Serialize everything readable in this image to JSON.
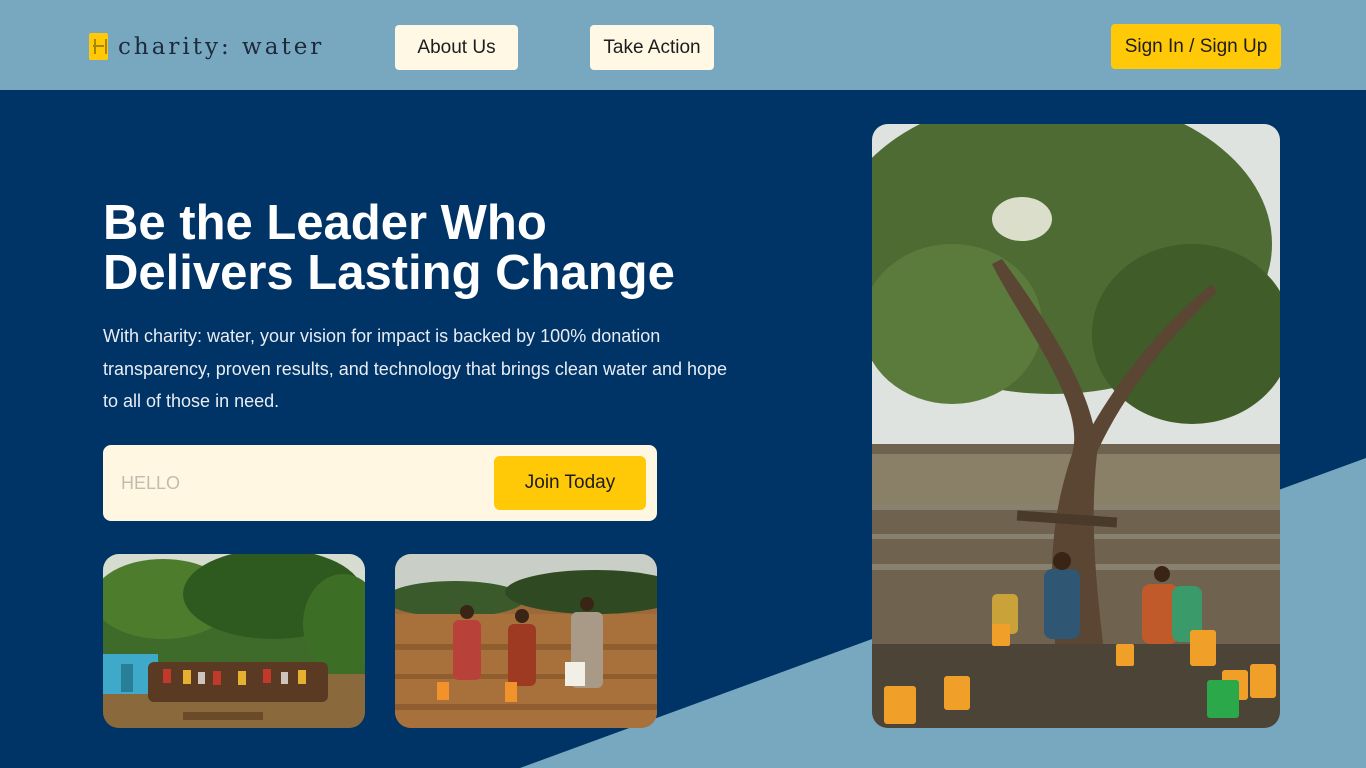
{
  "brand": {
    "name": "charity: water",
    "accent": "#ffc907",
    "navy": "#003366",
    "sky": "#77a8c0"
  },
  "nav": {
    "about_label": "About Us",
    "action_label": "Take Action",
    "signin_label": "Sign In / Sign Up"
  },
  "hero": {
    "title_line1": "Be the Leader Who",
    "title_line2": "Delivers Lasting Change",
    "description": "With charity: water, your vision for impact is backed by 100% donation transparency, proven results, and technology that brings clean water and hope to all of those in need."
  },
  "signup": {
    "placeholder": "HELLO",
    "button_label": "Join Today"
  },
  "icons": {
    "logo": "jerrycan-icon"
  }
}
